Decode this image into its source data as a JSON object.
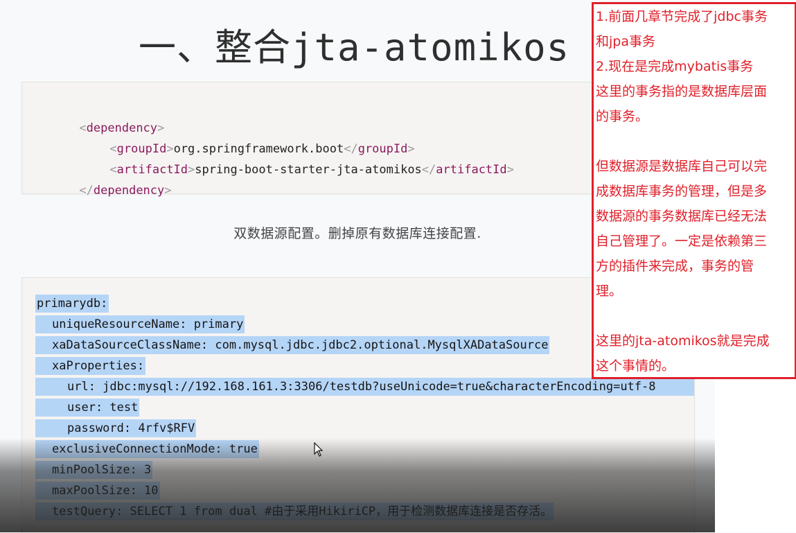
{
  "title": "一、整合jta-atomikos",
  "dependency_block": {
    "lines": [
      {
        "open": "<",
        "tag": "dependency",
        "close": ">",
        "value": "",
        "end_open": "",
        "end_tag": "",
        "end_close": ""
      },
      {
        "open": "<",
        "tag": "groupId",
        "close": ">",
        "value": "org.springframework.boot",
        "end_open": "</",
        "end_tag": "groupId",
        "end_close": ">"
      },
      {
        "open": "<",
        "tag": "artifactId",
        "close": ">",
        "value": "spring-boot-starter-jta-atomikos",
        "end_open": "</",
        "end_tag": "artifactId",
        "end_close": ">"
      },
      {
        "open": "</",
        "tag": "dependency",
        "close": ">",
        "value": "",
        "end_open": "",
        "end_tag": "",
        "end_close": ""
      }
    ]
  },
  "caption": "双数据源配置。删掉原有数据库连接配置.",
  "yaml_block": {
    "lines": [
      "primarydb:",
      "uniqueResourceName: primary",
      "xaDataSourceClassName: com.mysql.jdbc.jdbc2.optional.MysqlXADataSource",
      "xaProperties:",
      "url: jdbc:mysql://192.168.161.3:3306/testdb?useUnicode=true&characterEncoding=utf-8",
      "user: test",
      "password: 4rfv$RFV",
      "exclusiveConnectionMode: true",
      "minPoolSize: 3",
      "maxPoolSize: 10",
      "testQuery: SELECT 1 from dual #由于采用HikiriCP，用于检测数据库连接是否存活。"
    ]
  },
  "note": {
    "border_color": "#e0202a",
    "lines": [
      "1.前面几章节完成了jdbc事务",
      "和jpa事务",
      "2.现在是完成mybatis事务",
      "这里的事务指的是数据库层面",
      "的事务。",
      "",
      "但数据源是数据库自己可以完",
      "成数据库事务的管理，但是多",
      "数据源的事务数据库已经无法",
      "自己管理了。一定是依赖第三",
      "方的插件来完成，事务的管",
      "理。",
      "",
      "这里的jta-atomikos就是完成",
      "这个事情的。"
    ]
  },
  "colors": {
    "tag": "#8a1a5f",
    "selection": "#b5d5f7",
    "note_text": "#e0202a"
  }
}
